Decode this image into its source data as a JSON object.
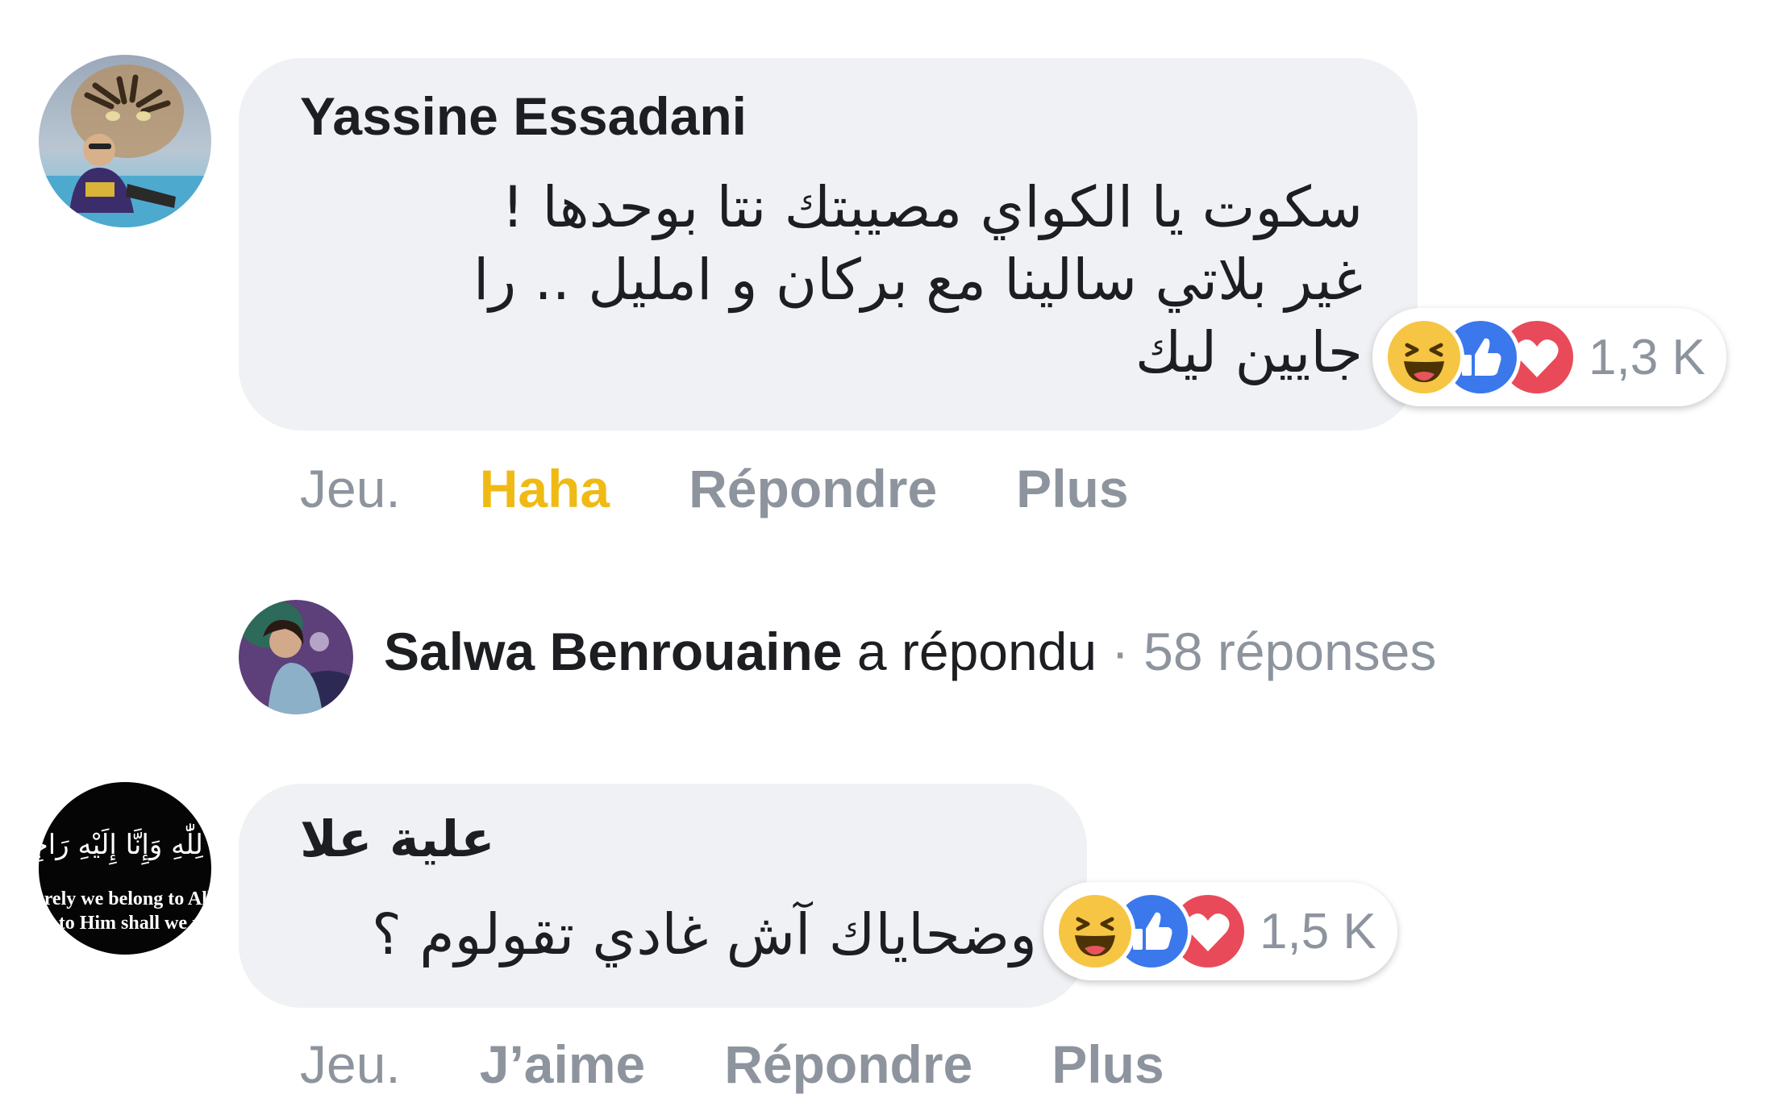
{
  "comments": [
    {
      "author": "Yassine Essadani",
      "lines": [
        "سكوت يا الكواي مصيبتك نتا بوحدها !",
        "غير بلاتي سالينا مع بركان و امليل .. را",
        "جايين ليك"
      ],
      "reactions": [
        "haha-icon",
        "like-icon",
        "love-icon"
      ],
      "reaction_count": "1,3 K",
      "actions": {
        "time": "Jeu.",
        "react": "Haha",
        "reply": "Répondre",
        "more": "Plus"
      }
    },
    {
      "author": "علية علا",
      "lines": [
        "وضحاياك آش غادي تقولوم ؟"
      ],
      "avatar_text": [
        "إِنَّا لِلّٰهِ وَإِنَّا إِلَيْهِ رَاجِعُونَ",
        "Surely we belong to Allah",
        "and to Him shall we return"
      ],
      "reactions": [
        "haha-icon",
        "like-icon",
        "love-icon"
      ],
      "reaction_count": "1,5 K",
      "actions": {
        "time": "Jeu.",
        "react": "J’aime",
        "reply": "Répondre",
        "more": "Plus"
      }
    }
  ],
  "reply_summary": {
    "replier": "Salwa Benrouaine",
    "verb": "a répondu",
    "separator": "·",
    "count": "58 réponses"
  },
  "colors": {
    "bubble": "#f0f1f4",
    "muted": "#8d949e",
    "haha_active": "#f0ba15",
    "like_blue": "#3a78ec",
    "love_red": "#e94a59",
    "haha_yellow": "#f6c543"
  }
}
